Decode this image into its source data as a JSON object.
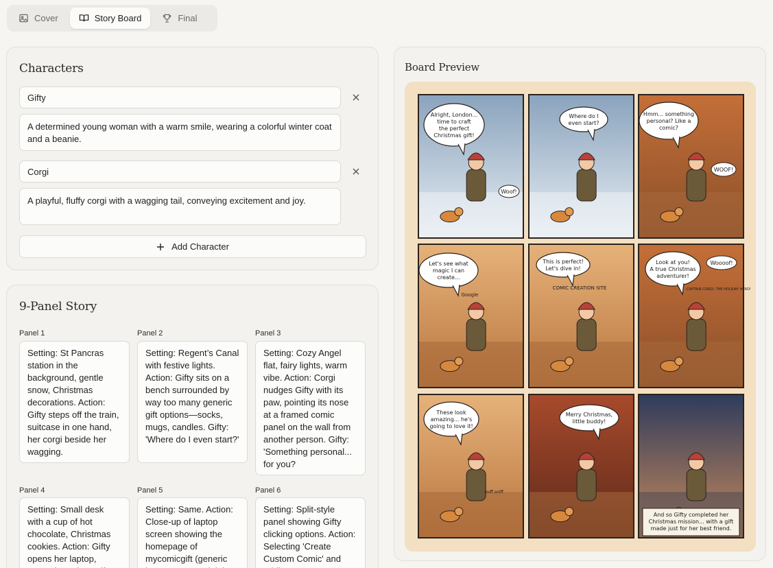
{
  "tabs": [
    {
      "label": "Cover",
      "icon": "image-icon",
      "active": false
    },
    {
      "label": "Story Board",
      "icon": "book-open-icon",
      "active": true
    },
    {
      "label": "Final",
      "icon": "trophy-icon",
      "active": false
    }
  ],
  "characters": {
    "title": "Characters",
    "items": [
      {
        "name": "Gifty",
        "description": "A determined young woman with a warm smile, wearing a colorful winter coat and a beanie."
      },
      {
        "name": "Corgi",
        "description": "A playful, fluffy corgi with a wagging tail, conveying excitement and joy."
      }
    ],
    "add_label": "Add Character"
  },
  "story": {
    "title": "9-Panel Story",
    "panels": [
      {
        "label": "Panel 1",
        "text": "Setting: St Pancras station in the background, gentle snow, Christmas decorations. Action: Gifty steps off the train, suitcase in one hand, her corgi beside her wagging."
      },
      {
        "label": "Panel 2",
        "text": "Setting: Regent’s Canal with festive lights. Action: Gifty sits on a bench surrounded by way too many generic gift options—socks, mugs, candles. Gifty: 'Where do I even start?'"
      },
      {
        "label": "Panel 3",
        "text": "Setting: Cozy Angel flat, fairy lights, warm vibe. Action: Corgi nudges Gifty with its paw, pointing its nose at a framed comic panel on the wall from another person. Gifty: 'Something personal... for you?"
      },
      {
        "label": "Panel 4",
        "text": "Setting: Small desk with a cup of hot chocolate, Christmas cookies. Action: Gifty opens her laptop, curser hovering. Gifty:"
      },
      {
        "label": "Panel 5",
        "text": "Setting: Same. Action: Close-up of laptop screen showing the homepage of mycomicgift (generic layout, no copyright)."
      },
      {
        "label": "Panel 6",
        "text": "Setting: Split-style panel showing Gifty clicking options. Action: Selecting 'Create Custom Comic' and adding"
      }
    ]
  },
  "preview": {
    "title": "Board Preview",
    "bubbles": [
      [
        "Alright, London...",
        "time to craft",
        "the perfect",
        "Christmas gift!"
      ],
      [
        "Where do I",
        "even start?"
      ],
      [
        "Hmm... something",
        "personal? Like a",
        "comic?"
      ],
      [
        "Let's see what",
        "magic I can",
        "create..."
      ],
      [
        "This is perfect!",
        "Let's dive in!"
      ],
      [
        "Look at you!",
        "A true Christmas",
        "adventurer!"
      ],
      [
        "These look",
        "amazing... he's",
        "going to love it!"
      ],
      [
        "Merry Christmas,",
        "little buddy!"
      ],
      [
        "And so Gifty completed her",
        "Christmas mission... with a gift",
        "made just for her best friend."
      ]
    ],
    "extra_text": {
      "woof1": "Woof!",
      "woof2": "WOOF!",
      "woooof": "Woooof!",
      "site_title": "COMIC CREATION SITE",
      "search": "Google",
      "poster": "CAPTAIN CORGI: THE HOLIDAY HERO!",
      "sniff": "sniff sniff"
    },
    "colors": {
      "panel_warm": "#d98e4a",
      "panel_night": "#3b4a6e",
      "panel_snow": "#a9bccc",
      "border": "#2a221c"
    }
  }
}
